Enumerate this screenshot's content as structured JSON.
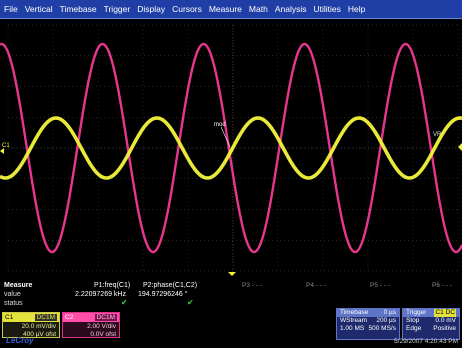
{
  "menu": [
    "File",
    "Vertical",
    "Timebase",
    "Trigger",
    "Display",
    "Cursors",
    "Measure",
    "Math",
    "Analysis",
    "Utilities",
    "Help"
  ],
  "screen": {
    "ground_marker": "C1",
    "level_marker": "mod",
    "right_marker": "VR"
  },
  "colors": {
    "c1": "#f5f53c",
    "c2": "#ff3c9c",
    "grid": "#4a4a4a",
    "menubar": "#1f3fa6"
  },
  "measure": {
    "title": "Measure",
    "row_value": "value",
    "row_status": "status",
    "p1_label": "P1:freq(C1)",
    "p1_value": "2.22097269 kHz",
    "p2_label": "P2:phase(C1,C2)",
    "p2_value": "194.97296246 °",
    "p3": "P3 - - -",
    "p4": "P4 - - -",
    "p5": "P5 - - -",
    "p6": "P6 - - -"
  },
  "c1_box": {
    "name": "C1",
    "coupling": "DC1M",
    "vdiv": "20.0 mV/div",
    "offset": "400 µV ofst"
  },
  "c2_box": {
    "name": "C2",
    "coupling": "DC1M",
    "vdiv": "2.00 V/div",
    "offset": "0.0V ofst"
  },
  "timebase": {
    "title": "Timebase",
    "delay": "0 µs",
    "mode": "WStream",
    "tdiv": "200 µs",
    "samples": "1.00 MS",
    "rate": "500 MS/s"
  },
  "trigger": {
    "title": "Trigger",
    "badge": "C1 DC",
    "mode": "Stop",
    "level": "0.0 mV",
    "type": "Edge",
    "slope": "Positive"
  },
  "logo": "LeCroy",
  "datetime": "5/29/2007 4:20:43 PM"
}
